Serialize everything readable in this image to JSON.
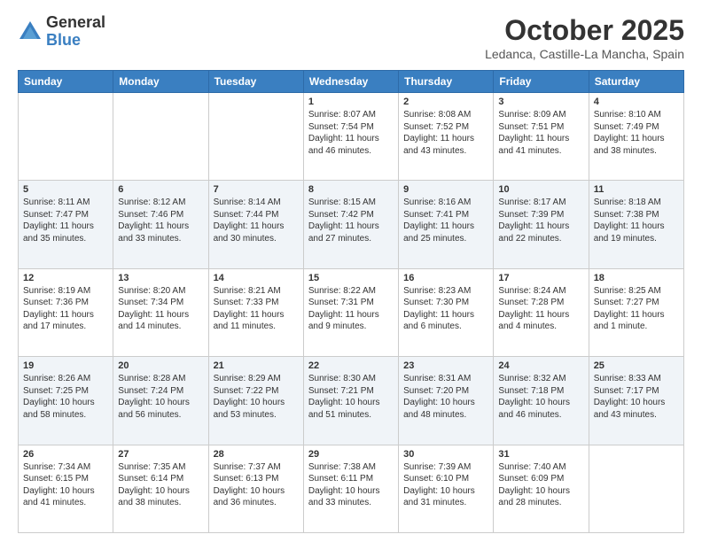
{
  "header": {
    "logo_general": "General",
    "logo_blue": "Blue",
    "month_title": "October 2025",
    "location": "Ledanca, Castille-La Mancha, Spain"
  },
  "days_of_week": [
    "Sunday",
    "Monday",
    "Tuesday",
    "Wednesday",
    "Thursday",
    "Friday",
    "Saturday"
  ],
  "weeks": [
    [
      {
        "day": "",
        "info": ""
      },
      {
        "day": "",
        "info": ""
      },
      {
        "day": "",
        "info": ""
      },
      {
        "day": "1",
        "info": "Sunrise: 8:07 AM\nSunset: 7:54 PM\nDaylight: 11 hours and 46 minutes."
      },
      {
        "day": "2",
        "info": "Sunrise: 8:08 AM\nSunset: 7:52 PM\nDaylight: 11 hours and 43 minutes."
      },
      {
        "day": "3",
        "info": "Sunrise: 8:09 AM\nSunset: 7:51 PM\nDaylight: 11 hours and 41 minutes."
      },
      {
        "day": "4",
        "info": "Sunrise: 8:10 AM\nSunset: 7:49 PM\nDaylight: 11 hours and 38 minutes."
      }
    ],
    [
      {
        "day": "5",
        "info": "Sunrise: 8:11 AM\nSunset: 7:47 PM\nDaylight: 11 hours and 35 minutes."
      },
      {
        "day": "6",
        "info": "Sunrise: 8:12 AM\nSunset: 7:46 PM\nDaylight: 11 hours and 33 minutes."
      },
      {
        "day": "7",
        "info": "Sunrise: 8:14 AM\nSunset: 7:44 PM\nDaylight: 11 hours and 30 minutes."
      },
      {
        "day": "8",
        "info": "Sunrise: 8:15 AM\nSunset: 7:42 PM\nDaylight: 11 hours and 27 minutes."
      },
      {
        "day": "9",
        "info": "Sunrise: 8:16 AM\nSunset: 7:41 PM\nDaylight: 11 hours and 25 minutes."
      },
      {
        "day": "10",
        "info": "Sunrise: 8:17 AM\nSunset: 7:39 PM\nDaylight: 11 hours and 22 minutes."
      },
      {
        "day": "11",
        "info": "Sunrise: 8:18 AM\nSunset: 7:38 PM\nDaylight: 11 hours and 19 minutes."
      }
    ],
    [
      {
        "day": "12",
        "info": "Sunrise: 8:19 AM\nSunset: 7:36 PM\nDaylight: 11 hours and 17 minutes."
      },
      {
        "day": "13",
        "info": "Sunrise: 8:20 AM\nSunset: 7:34 PM\nDaylight: 11 hours and 14 minutes."
      },
      {
        "day": "14",
        "info": "Sunrise: 8:21 AM\nSunset: 7:33 PM\nDaylight: 11 hours and 11 minutes."
      },
      {
        "day": "15",
        "info": "Sunrise: 8:22 AM\nSunset: 7:31 PM\nDaylight: 11 hours and 9 minutes."
      },
      {
        "day": "16",
        "info": "Sunrise: 8:23 AM\nSunset: 7:30 PM\nDaylight: 11 hours and 6 minutes."
      },
      {
        "day": "17",
        "info": "Sunrise: 8:24 AM\nSunset: 7:28 PM\nDaylight: 11 hours and 4 minutes."
      },
      {
        "day": "18",
        "info": "Sunrise: 8:25 AM\nSunset: 7:27 PM\nDaylight: 11 hours and 1 minute."
      }
    ],
    [
      {
        "day": "19",
        "info": "Sunrise: 8:26 AM\nSunset: 7:25 PM\nDaylight: 10 hours and 58 minutes."
      },
      {
        "day": "20",
        "info": "Sunrise: 8:28 AM\nSunset: 7:24 PM\nDaylight: 10 hours and 56 minutes."
      },
      {
        "day": "21",
        "info": "Sunrise: 8:29 AM\nSunset: 7:22 PM\nDaylight: 10 hours and 53 minutes."
      },
      {
        "day": "22",
        "info": "Sunrise: 8:30 AM\nSunset: 7:21 PM\nDaylight: 10 hours and 51 minutes."
      },
      {
        "day": "23",
        "info": "Sunrise: 8:31 AM\nSunset: 7:20 PM\nDaylight: 10 hours and 48 minutes."
      },
      {
        "day": "24",
        "info": "Sunrise: 8:32 AM\nSunset: 7:18 PM\nDaylight: 10 hours and 46 minutes."
      },
      {
        "day": "25",
        "info": "Sunrise: 8:33 AM\nSunset: 7:17 PM\nDaylight: 10 hours and 43 minutes."
      }
    ],
    [
      {
        "day": "26",
        "info": "Sunrise: 7:34 AM\nSunset: 6:15 PM\nDaylight: 10 hours and 41 minutes."
      },
      {
        "day": "27",
        "info": "Sunrise: 7:35 AM\nSunset: 6:14 PM\nDaylight: 10 hours and 38 minutes."
      },
      {
        "day": "28",
        "info": "Sunrise: 7:37 AM\nSunset: 6:13 PM\nDaylight: 10 hours and 36 minutes."
      },
      {
        "day": "29",
        "info": "Sunrise: 7:38 AM\nSunset: 6:11 PM\nDaylight: 10 hours and 33 minutes."
      },
      {
        "day": "30",
        "info": "Sunrise: 7:39 AM\nSunset: 6:10 PM\nDaylight: 10 hours and 31 minutes."
      },
      {
        "day": "31",
        "info": "Sunrise: 7:40 AM\nSunset: 6:09 PM\nDaylight: 10 hours and 28 minutes."
      },
      {
        "day": "",
        "info": ""
      }
    ]
  ]
}
